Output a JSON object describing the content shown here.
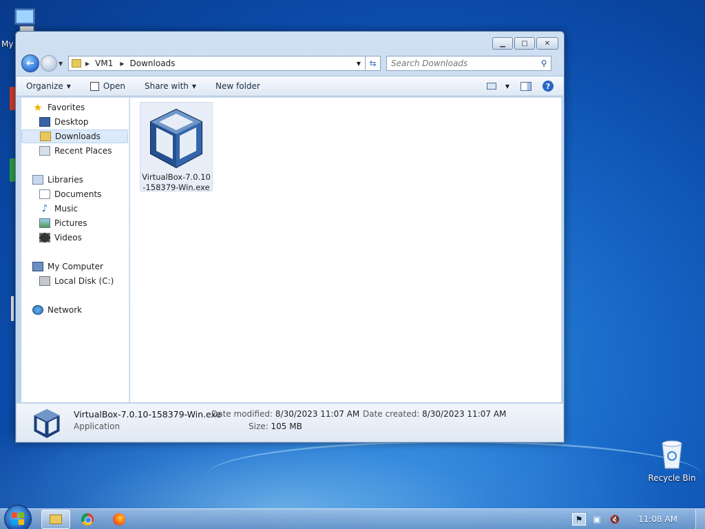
{
  "desktop": {
    "my_computer_label": "My",
    "recycle_bin_label": "Recycle Bin"
  },
  "window": {
    "caption_buttons": {
      "minimize": "▁",
      "maximize": "□",
      "close": "✕"
    },
    "address": {
      "crumbs": [
        "VM1",
        "Downloads"
      ]
    },
    "search": {
      "placeholder": "Search Downloads"
    },
    "toolbar": {
      "organize": "Organize",
      "open": "Open",
      "share_with": "Share with",
      "new_folder": "New folder",
      "help": "?"
    },
    "nav": {
      "favorites": "Favorites",
      "desktop": "Desktop",
      "downloads": "Downloads",
      "recent_places": "Recent Places",
      "libraries": "Libraries",
      "documents": "Documents",
      "music": "Music",
      "pictures": "Pictures",
      "videos": "Videos",
      "my_computer": "My Computer",
      "local_disk": "Local Disk (C:)",
      "network": "Network"
    },
    "files": [
      {
        "name": "VirtualBox-7.0.10-158379-Win.exe"
      }
    ],
    "details": {
      "name": "VirtualBox-7.0.10-158379-Win.exe",
      "type": "Application",
      "date_modified_label": "Date modified:",
      "date_modified": "8/30/2023 11:07 AM",
      "date_created_label": "Date created:",
      "date_created": "8/30/2023 11:07 AM",
      "size_label": "Size:",
      "size": "105 MB"
    }
  },
  "taskbar": {
    "clock": "11:08 AM"
  },
  "colors": {
    "selection": "#dbe9fa",
    "wallpaper": "#1664c4",
    "window_frame": "#b9d0ea"
  }
}
